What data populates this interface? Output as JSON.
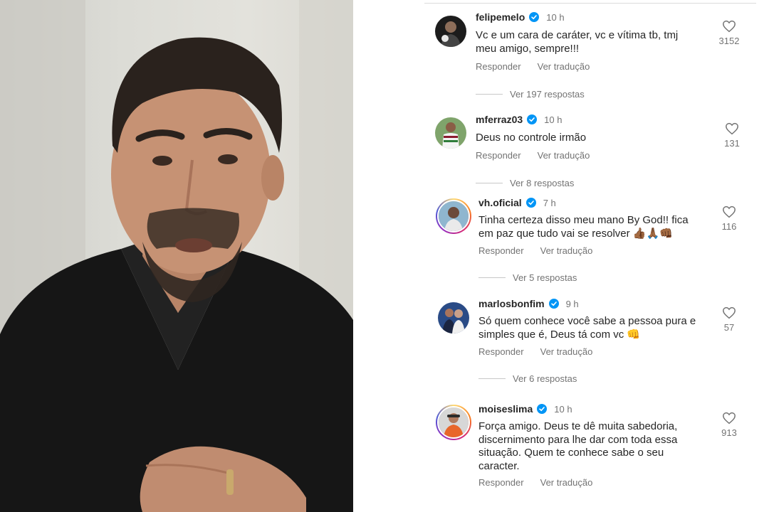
{
  "video_frame": {
    "description_icon": "person-speaking-photo"
  },
  "comments": [
    {
      "username": "felipemelo",
      "verified": true,
      "time": "10 h",
      "text": "Vc e um cara de caráter, vc e vítima tb, tmj meu amigo, sempre!!!",
      "likes": "3152",
      "reply_label": "Responder",
      "translate_label": "Ver tradução",
      "view_replies": "Ver 197 respostas"
    },
    {
      "username": "mferraz03",
      "verified": true,
      "time": "10 h",
      "text": "Deus no controle irmão",
      "likes": "131",
      "reply_label": "Responder",
      "translate_label": "Ver tradução",
      "view_replies": "Ver 8 respostas"
    },
    {
      "username": "vh.oficial",
      "verified": true,
      "time": "7 h",
      "text": "Tinha certeza disso meu mano By God!! fica em paz que tudo vai se resolver 👍🏾🙏🏾👊🏾",
      "likes": "116",
      "reply_label": "Responder",
      "translate_label": "Ver tradução",
      "view_replies": "Ver 5 respostas"
    },
    {
      "username": "marlosbonfim",
      "verified": true,
      "time": "9 h",
      "text": "Só quem conhece você sabe a pessoa pura e simples que é, Deus tá com vc 👊",
      "likes": "57",
      "reply_label": "Responder",
      "translate_label": "Ver tradução",
      "view_replies": "Ver 6 respostas"
    },
    {
      "username": "moiseslima",
      "verified": true,
      "time": "10 h",
      "text": "Força amigo. Deus te dê muita sabedoria, discernimento para lhe dar com toda essa situação. Quem te conhece sabe o seu caracter.",
      "likes": "913",
      "reply_label": "Responder",
      "translate_label": "Ver tradução"
    }
  ],
  "colors": {
    "verified_blue": "#0095f6",
    "secondary_text": "#737373",
    "primary_text": "#262626"
  }
}
